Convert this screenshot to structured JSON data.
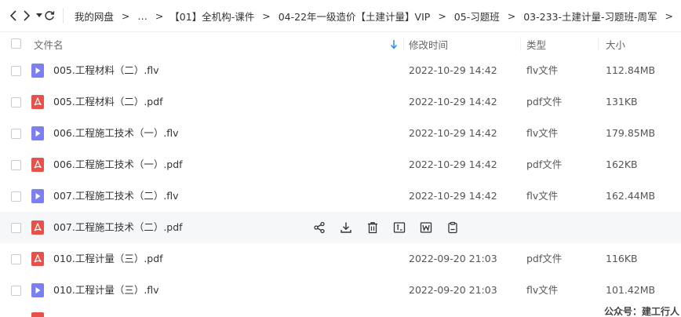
{
  "breadcrumb": {
    "items": [
      "我的网盘",
      "…",
      "【01】全机构-课件",
      "04-22年一级造价【土建计量】VIP",
      "05-习题班",
      "03-233-土建计量-习题班-周军"
    ],
    "separator": ">",
    "trailing": ">"
  },
  "columns": {
    "name": "文件名",
    "modified": "修改时间",
    "type": "类型",
    "size": "大小"
  },
  "files": [
    {
      "name": "005.工程材料（二）.flv",
      "date": "2022-10-29 14:42",
      "type": "flv文件",
      "size": "112.84MB",
      "icon": "video-file-icon"
    },
    {
      "name": "005.工程材料（二）.pdf",
      "date": "2022-10-29 14:42",
      "type": "pdf文件",
      "size": "131KB",
      "icon": "pdf-file-icon"
    },
    {
      "name": "006.工程施工技术（一）.flv",
      "date": "2022-10-29 14:42",
      "type": "flv文件",
      "size": "179.85MB",
      "icon": "video-file-icon"
    },
    {
      "name": "006.工程施工技术（一）.pdf",
      "date": "2022-10-29 14:42",
      "type": "pdf文件",
      "size": "162KB",
      "icon": "pdf-file-icon"
    },
    {
      "name": "007.工程施工技术（二）.flv",
      "date": "2022-10-29 14:42",
      "type": "flv文件",
      "size": "162.44MB",
      "icon": "video-file-icon"
    },
    {
      "name": "007.工程施工技术（二）.pdf",
      "date": "",
      "type": "",
      "size": "",
      "icon": "pdf-file-icon",
      "hovered": true
    },
    {
      "name": "010.工程计量（三）.pdf",
      "date": "2022-09-20 21:03",
      "type": "pdf文件",
      "size": "116KB",
      "icon": "pdf-file-icon"
    },
    {
      "name": "010.工程计量（三）.flv",
      "date": "2022-09-20 21:03",
      "type": "flv文件",
      "size": "101.42MB",
      "icon": "video-file-icon"
    }
  ],
  "row_actions": [
    "share-icon",
    "download-icon",
    "delete-icon",
    "text-preview-icon",
    "word-icon",
    "clipboard-icon"
  ],
  "watermark": "公众号：建工行人",
  "colors": {
    "video": "#7b7ff0",
    "pdf": "#e8504a",
    "sort_arrow": "#2d8cf0"
  }
}
